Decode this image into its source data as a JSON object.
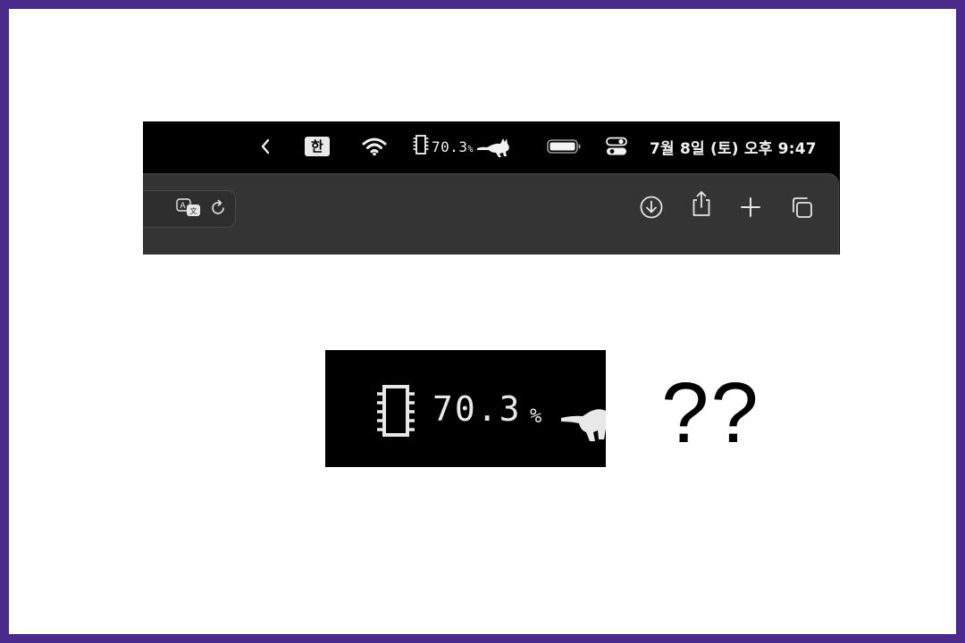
{
  "menubar": {
    "chevron": "‹",
    "input_method": "한",
    "cpu_value": "70.3",
    "cpu_unit": "%",
    "clock": "7월 8일 (토) 오후 9:47",
    "icons": [
      "chevron-left-icon",
      "input-method-icon",
      "wifi-icon",
      "cpu-chip-icon",
      "runcat-icon",
      "battery-icon",
      "control-center-icon"
    ]
  },
  "toolbar": {
    "url_field_icons": [
      "translate-icon",
      "reload-icon"
    ],
    "buttons": [
      "download-icon",
      "share-icon",
      "new-tab-icon",
      "tab-overview-icon"
    ]
  },
  "zoom": {
    "cpu_value": "70.3",
    "cpu_unit": "%"
  },
  "annotation": {
    "text": "??"
  },
  "colors": {
    "frame": "#4a2a8a",
    "menubar_bg": "#000000",
    "toolbar_bg": "#343434",
    "icon": "#e6e6e6"
  }
}
